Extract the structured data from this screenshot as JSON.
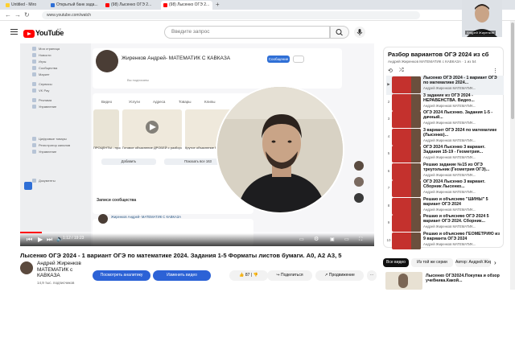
{
  "browser": {
    "tabs": [
      {
        "label": "Untitled - Miro",
        "color": "#ffd02f"
      },
      {
        "label": "Открытый банк зада...",
        "color": "#2f6fd6"
      },
      {
        "label": "(98) Лысенко ОГЭ 2...",
        "color": "#ff0000"
      },
      {
        "label": "(98) Лысенко ОГЭ 2...",
        "color": "#ff0000"
      }
    ],
    "url": "www.youtube.com/watch"
  },
  "header": {
    "logo_text": "YouTube",
    "country": "KZ",
    "search_placeholder": "Введите запрос"
  },
  "player": {
    "current_time": "1:12 / 19:23",
    "progress_fraction": 0.062,
    "vk": {
      "menu": [
        "Моя страница",
        "Новости",
        "Игры",
        "Сообщества",
        "Маркет",
        "Сервисы",
        "VK Pay",
        "Реклама",
        "Управление",
        "Цифровые товары",
        "Регистратор каналов",
        "Управление",
        "Документы"
      ],
      "name": "Жиренков Андрей- МАТЕМАТИК С КАВКАЗА",
      "subscribers": "Вы подписаны",
      "message_button": "Сообщение",
      "tabs": [
        "Видео",
        "Услуги",
        "Адреса",
        "Товары",
        "Клипы"
      ],
      "captions": [
        "ПРОЦЕНТЫ - просто",
        "Готовое объяснение ДРОБЕЙ с разбором",
        "Крутое объяснение РЕАЛИСТИЧНЫХ задач"
      ],
      "add_button": "Добавить",
      "show_all_button": "Показать все 163",
      "post_title": "Записи сообщества",
      "post_author": "Жиренков Андрей- МАТЕМАТИК С КАВКАЗА"
    }
  },
  "video": {
    "title": "Лысенко ОГЭ 2024 - 1 вариант ОГЭ по математике 2024. Задания 1-5 Форматы листов бумаги. А0, А2 А3, 5",
    "channel_name": "Андрей Жиренков МАТЕМАТИК с КАВКАЗА",
    "channel_subs": "14,9 тыс. подписчиков",
    "analytics_button": "Посмотреть аналитику",
    "edit_button": "Изменить видео",
    "likes": "87",
    "share": "Поделиться",
    "promote": "Продвижение",
    "more": "⋯"
  },
  "playlist": {
    "title": "Разбор вариантов ОГЭ 2024 из сборника",
    "subtitle": "Андрей Жиренков МАТЕМАТИК с КАВКАЗА · 1 из 54",
    "items": [
      {
        "num": "▶",
        "title": "Лысенко ОГЭ 2024 - 1 вариант ОГЭ по математике 2024...",
        "channel": "Андрей Жиренков МАТЕМАТИК...",
        "duration": "19:23"
      },
      {
        "num": "2",
        "title": "3 задание из ОГЭ 2024 - НЕРАВЕНСТВА. Видео...",
        "channel": "Андрей Жиренков МАТЕМАТИК...",
        "duration": "6:58"
      },
      {
        "num": "3",
        "title": "ОГЭ 2024 Лысенко. Задания 1-5 - дачный...",
        "channel": "Андрей Жиренков МАТЕМАТИК...",
        "duration": "9:14"
      },
      {
        "num": "4",
        "title": "3 вариант ОГЭ 2024 по математике (Лысенко)...",
        "channel": "Андрей Жиренков МАТЕМАТИК...",
        "duration": "22:17"
      },
      {
        "num": "5",
        "title": "ОГЭ 2024 Лысенко 3 вариант. Задания 15-19 - Геометрия...",
        "channel": "Андрей Жиренков МАТЕМАТИК...",
        "duration": "8:40"
      },
      {
        "num": "6",
        "title": "Решаю задание №15 из ОГЭ треугольник (Геометрия ОГЭ)...",
        "channel": "Андрей Жиренков МАТЕМАТИК...",
        "duration": "4:05"
      },
      {
        "num": "7",
        "title": "ОГЭ 2024 Лысенко 3 вариант. Сборник Лысенко...",
        "channel": "Андрей Жиренков МАТЕМАТИК...",
        "duration": "11:30"
      },
      {
        "num": "8",
        "title": "Решаю и объясняю \"ШИНЫ\" 5 вариант ОГЭ 2024",
        "channel": "Андрей Жиренков МАТЕМАТИК...",
        "duration": "26:17"
      },
      {
        "num": "9",
        "title": "Решаю и объясняю ОГЭ 2024 5 вариант ОГЭ 2024. Сборник...",
        "channel": "Андрей Жиренков МАТЕМАТИК...",
        "duration": "14:02"
      },
      {
        "num": "10",
        "title": "Решаю и объясняю ГЕОМЕТРИЮ из 9 варианта ОГЭ 2024",
        "channel": "Андрей Жиренков МАТЕМАТИК...",
        "duration": "12:45"
      }
    ]
  },
  "chips": {
    "all": "Все видео",
    "series": "Из той же серии",
    "author": "Автор: Андрей Жиренков"
  },
  "recommended": {
    "title": "Лысенко ОГЭ2024.Покупка и обзор учебника.Какой..."
  },
  "webcam": {
    "label": "Андрей Жиренков"
  }
}
